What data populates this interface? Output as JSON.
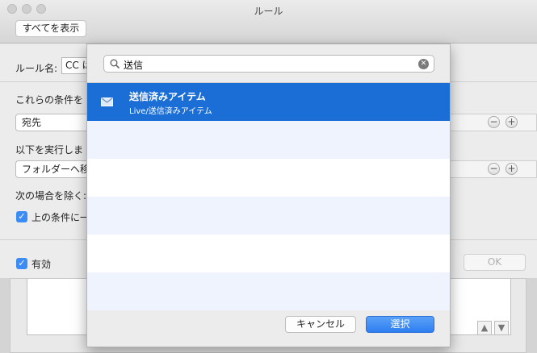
{
  "window": {
    "title": "ルール",
    "show_all_label": "すべてを表示"
  },
  "rule": {
    "name_label": "ルール名:",
    "name_value": "CC は"
  },
  "conditions": {
    "label": "これらの条件を",
    "popup_value": "宛先"
  },
  "actions": {
    "label": "以下を実行しま",
    "popup_value": "フォルダーへ移"
  },
  "exceptions": {
    "label": "次の場合を除く:",
    "checkbox_label": "上の条件に一"
  },
  "footer": {
    "enabled_label": "有効",
    "ok_label": "OK"
  },
  "chooser": {
    "search_value": "送信",
    "results": [
      {
        "title": "送信済みアイテム",
        "path": "Live/送信済みアイテム"
      }
    ],
    "cancel_label": "キャンセル",
    "select_label": "選択"
  },
  "colors": {
    "selection": "#1b6ed6",
    "accent": "#3b8cf5"
  }
}
